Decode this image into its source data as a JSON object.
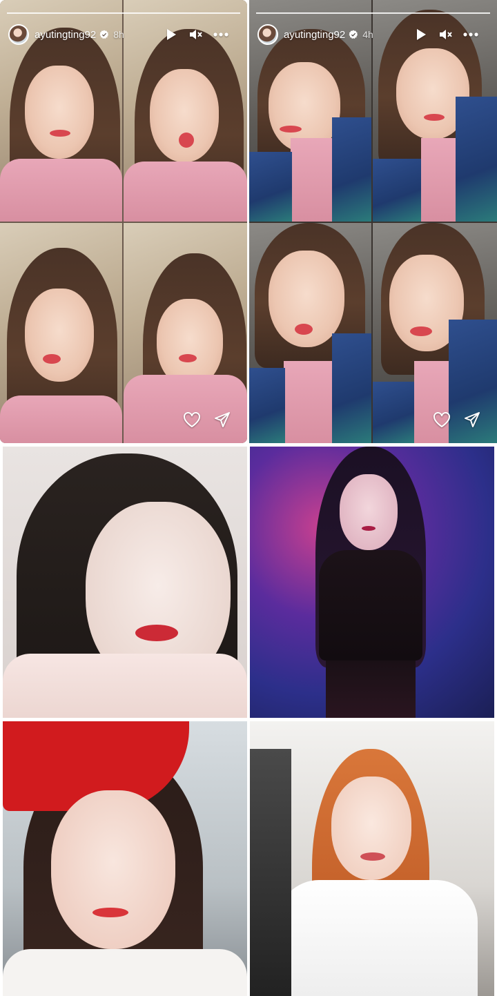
{
  "stories": [
    {
      "username": "ayutingting92",
      "time": "8h",
      "progress_segments": 1,
      "verified": true,
      "controls": [
        "play-icon",
        "mute-icon",
        "more-icon"
      ]
    },
    {
      "username": "ayutingting92",
      "time": "4h",
      "progress_segments": 1,
      "verified": true,
      "controls": [
        "play-icon",
        "mute-icon",
        "more-icon"
      ],
      "footer_controls": [
        "heart-icon",
        "send-icon"
      ]
    }
  ],
  "colors": {
    "verified_badge": "#ffffff",
    "overlay_text": "#ffffff"
  }
}
